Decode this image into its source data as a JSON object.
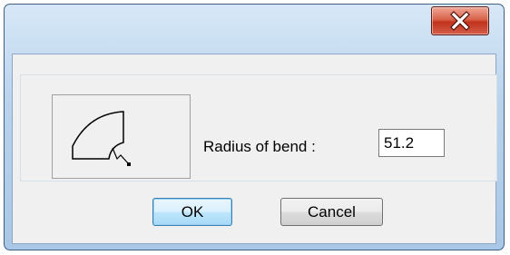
{
  "window": {
    "close_button": {
      "icon": "close-icon",
      "glyph": "x",
      "color": "#c2321b"
    }
  },
  "dialog": {
    "diagram": {
      "icon": "bend-radius-icon"
    },
    "radius_label": "Radius of bend :",
    "radius_value": "51.2",
    "ok_label": "OK",
    "cancel_label": "Cancel"
  }
}
